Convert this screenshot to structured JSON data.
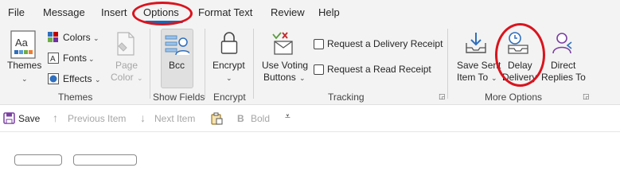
{
  "menu": {
    "tabs": [
      "File",
      "Message",
      "Insert",
      "Options",
      "Format Text",
      "Review",
      "Help"
    ],
    "active_tab": "Options",
    "accent_color": "#0f6cbd",
    "annotation_color": "#d9141e"
  },
  "ribbon": {
    "themes": {
      "themes_label": "Themes",
      "colors_label": "Colors",
      "fonts_label": "Fonts",
      "effects_label": "Effects",
      "page_color_line1": "Page",
      "page_color_line2": "Color",
      "group_label": "Themes"
    },
    "show_fields": {
      "bcc_label": "Bcc",
      "group_label": "Show Fields"
    },
    "encrypt": {
      "encrypt_label": "Encrypt",
      "group_label": "Encrypt"
    },
    "tracking": {
      "voting_line1": "Use Voting",
      "voting_line2": "Buttons",
      "delivery_receipt": "Request a Delivery Receipt",
      "read_receipt": "Request a Read Receipt",
      "group_label": "Tracking"
    },
    "more_options": {
      "save_sent_line1": "Save Sent",
      "save_sent_line2": "Item To",
      "delay_line1": "Delay",
      "delay_line2": "Delivery",
      "direct_line1": "Direct",
      "direct_line2": "Replies To",
      "group_label": "More Options"
    }
  },
  "quick_access": {
    "save": "Save",
    "previous_item": "Previous Item",
    "next_item": "Next Item",
    "bold": "Bold"
  }
}
